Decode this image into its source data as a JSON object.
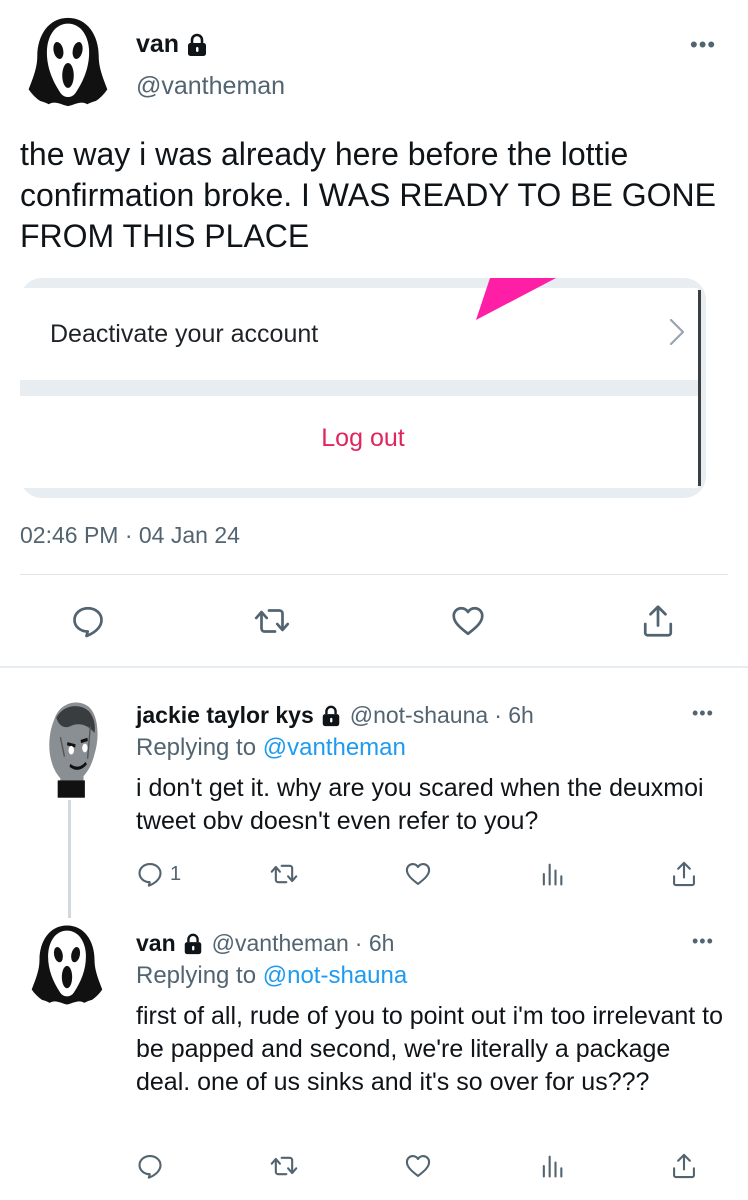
{
  "main_tweet": {
    "name": "van",
    "handle": "@vantheman",
    "text": "the way i was already here before the lottie confirmation broke. I WAS READY TO BE GONE FROM THIS PLACE",
    "embed": {
      "deactivate_label": "Deactivate your account",
      "logout_label": "Log out"
    },
    "timestamp": "02:46 PM · 04 Jan 24"
  },
  "replies": [
    {
      "name": "jackie taylor kys",
      "handle": "@not-shauna",
      "time": "· 6h",
      "replying_prefix": "Replying to",
      "replying_to": "@vantheman",
      "text": "i don't get it. why are you scared when the deuxmoi tweet obv doesn't even refer to you?",
      "reply_count": "1"
    },
    {
      "name": "van",
      "handle": "@vantheman",
      "time": "· 6h",
      "replying_prefix": "Replying to",
      "replying_to": "@not-shauna",
      "text": "first of all, rude of you to point out i'm too irrelevant to be papped and second, we're literally a package deal. one of us sinks and it's so over for us???",
      "reply_count": ""
    }
  ],
  "colors": {
    "accent": "#1d9bf0",
    "logout": "#e0245e",
    "muted": "#536471",
    "pink_triangle": "#ff1fa7"
  }
}
